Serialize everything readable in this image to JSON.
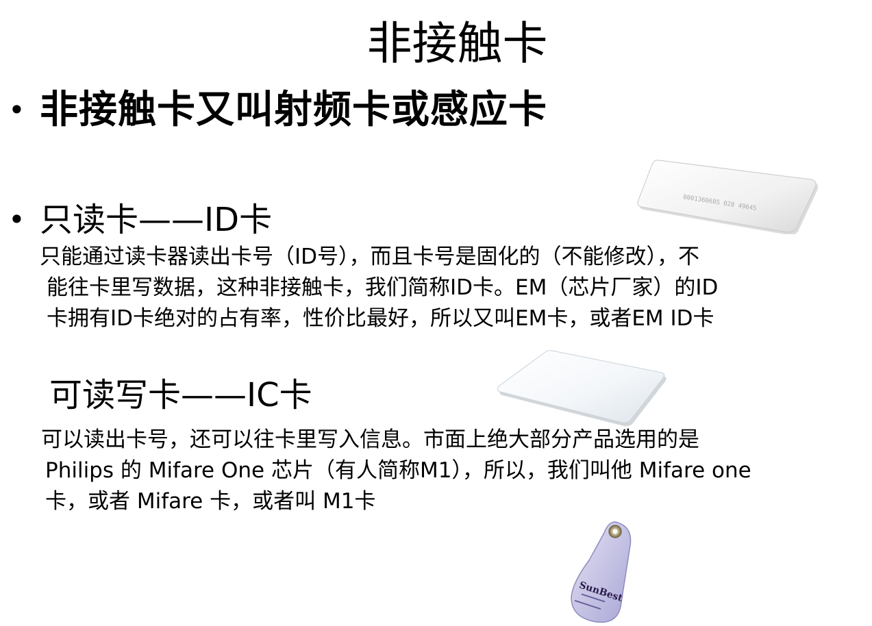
{
  "title": "非接触卡",
  "bullet1": {
    "marker": "•",
    "text": "非接触卡又叫射频卡或感应卡"
  },
  "bullet2": {
    "marker": "•",
    "text": "只读卡——ID卡"
  },
  "id_card_description": {
    "line1": "只能通过读卡器读出卡号（ID号），而且卡号是固化的（不能修改），不",
    "line2": "能往卡里写数据，这种非接触卡，我们简称ID卡。EM（芯片厂家）的ID",
    "line3": "卡拥有ID卡绝对的占有率，性价比最好，所以又叫EM卡，或者EM ID卡"
  },
  "ic_heading": "可读写卡——IC卡",
  "ic_card_description": {
    "line1": "可以读出卡号，还可以往卡里写入信息。市面上绝大部分产品选用的是",
    "line2": "Philips 的 Mifare One 芯片（有人简称M1），所以，我们叫他 Mifare one",
    "line3": "卡，或者 Mifare 卡，或者叫 M1卡"
  },
  "images": {
    "id_card_print": "0001360605 020 49645",
    "keyfob_brand": "SunBest"
  }
}
